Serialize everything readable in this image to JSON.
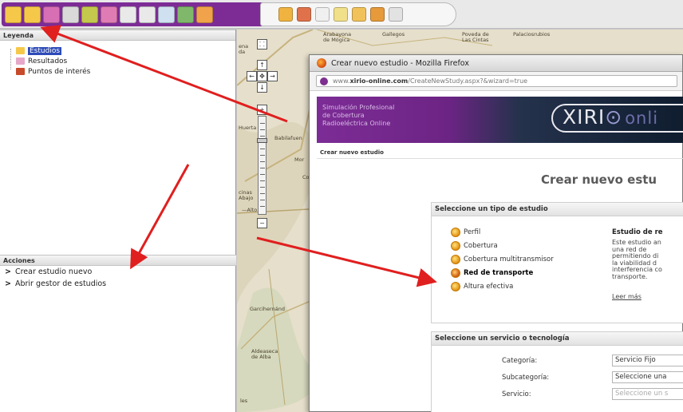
{
  "toolbar": {
    "group1_icons": [
      "open-folder-icon",
      "folder-icon",
      "folder-purple-icon",
      "gear-icon",
      "puzzle-icon",
      "puzzle-pink-icon",
      "grid-icon",
      "grid-alt-icon",
      "refresh-icon",
      "layers-icon",
      "people-icon"
    ],
    "group1_colors": [
      "#f6c84a",
      "#f6c84a",
      "#d86fb5",
      "#d9d9d9",
      "#c4c84c",
      "#e07cb4",
      "#e9e9e9",
      "#e9e9e9",
      "#cfe0f0",
      "#7fb86a",
      "#f0a34a"
    ],
    "group2_icons": [
      "flag-icon",
      "butterfly-icon",
      "hand-icon",
      "km-icon",
      "chart-icon",
      "points-icon",
      "printer-icon"
    ],
    "group2_colors": [
      "#f0b340",
      "#e0724b",
      "#f0f0f0",
      "#f1e08a",
      "#f2c25a",
      "#e69a3a",
      "#e2e2e2"
    ]
  },
  "legend": {
    "title": "Leyenda",
    "items": [
      {
        "label": "Estudios",
        "icon": "folder-icon",
        "color": "#f6c84a",
        "selected": true
      },
      {
        "label": "Resultados",
        "icon": "folder-pink-icon",
        "color": "#e6a8c9",
        "selected": false
      },
      {
        "label": "Puntos de interés",
        "icon": "flag-icon",
        "color": "#c74a2b",
        "selected": false
      }
    ]
  },
  "actions": {
    "title": "Acciones",
    "items": [
      "Crear estudio nuevo",
      "Abrir gestor de estudios"
    ]
  },
  "map": {
    "labels": {
      "top_a": "Arabayona\nde Mógica",
      "top_b": "Gallegos",
      "top_c": "Poveda de\nLas Cintas",
      "top_d": "Palaciosrubios",
      "left_a": "ena\nda",
      "babilafuente": "Babilafuen",
      "huerta": "Huerta",
      "mor": "Mor",
      "co": "Co",
      "encinas": "cinas\nAbajo",
      "alto": "—Alto",
      "garcihernandez": "Garcihernánd",
      "aldeaseca": "Aldeaseca\nde Alba",
      "bottom_left": "les"
    },
    "zoom": {
      "up": "↑",
      "left": "←",
      "center": "✥",
      "right": "→",
      "down": "↓",
      "plus": "+",
      "minus": "−"
    }
  },
  "popup": {
    "window_title": "Crear nuevo estudio - Mozilla Firefox",
    "url_prefix": "www.",
    "url_domain": "xirio-online.com",
    "url_rest": "/CreateNewStudy.aspx?&wizard=true",
    "banner_text": [
      "Simulación Profesional",
      "de Cobertura",
      "Radioeléctrica Online"
    ],
    "logo_a": "XIRI",
    "logo_b": "⊙",
    "logo_c": "onli",
    "breadcrumb": "Crear nuevo estudio",
    "heading": "Crear nuevo estu",
    "study_type": {
      "header": "Seleccione un tipo de estudio",
      "options": [
        "Perfil",
        "Cobertura",
        "Cobertura multitransmisor",
        "Red de transporte",
        "Altura efectiva"
      ],
      "selected_index": 3,
      "desc_title": "Estudio de re",
      "desc_lines": [
        "Este estudio an",
        "una   red   de",
        "permitiendo di",
        "la  viabilidad  d",
        "interferencia co",
        "transporte."
      ],
      "desc_more": "Leer más"
    },
    "service": {
      "header": "Seleccione un servicio o tecnología",
      "fields": [
        {
          "label": "Categoría:",
          "value": "Servicio Fijo",
          "dim": false
        },
        {
          "label": "Subcategoría:",
          "value": "Seleccione una",
          "dim": false
        },
        {
          "label": "Servicio:",
          "value": "Seleccione un s",
          "dim": true
        }
      ]
    }
  },
  "colors": {
    "arrow": "#e01f1f",
    "brand_purple": "#7d2c96"
  }
}
